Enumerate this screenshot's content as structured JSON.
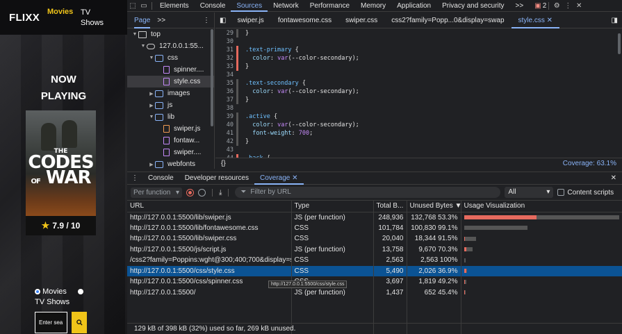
{
  "app": {
    "logo": "FLIXX",
    "nav_movies": "Movies",
    "nav_tv": "TV Shows",
    "now_playing": "NOW PLAYING",
    "poster_the": "THE",
    "poster_title_1": "CODES",
    "poster_of": "OF",
    "poster_title_2": "WAR",
    "rating": "7.9 / 10",
    "radio_movies": "Movies",
    "radio_tv": "TV Shows",
    "search_placeholder": "Enter sea",
    "search_icon": "search-icon"
  },
  "devtools": {
    "top_tabs": [
      "Elements",
      "Console",
      "Sources",
      "Network",
      "Performance",
      "Memory",
      "Application",
      "Privacy and security"
    ],
    "active_top_tab": "Sources",
    "more": ">>",
    "issues_count": "2",
    "navigator": {
      "tab": "Page",
      "more": ">>",
      "items": [
        {
          "label": "top",
          "depth": 0,
          "caret": "▼",
          "icon": "frame"
        },
        {
          "label": "127.0.0.1:55...",
          "depth": 1,
          "caret": "▼",
          "icon": "cloud"
        },
        {
          "label": "css",
          "depth": 2,
          "caret": "▼",
          "icon": "folder"
        },
        {
          "label": "spinner....",
          "depth": 3,
          "caret": "",
          "icon": "file-p"
        },
        {
          "label": "style.css",
          "depth": 3,
          "caret": "",
          "icon": "file-p",
          "selected": true
        },
        {
          "label": "images",
          "depth": 2,
          "caret": "▶",
          "icon": "folder"
        },
        {
          "label": "js",
          "depth": 2,
          "caret": "▶",
          "icon": "folder"
        },
        {
          "label": "lib",
          "depth": 2,
          "caret": "▼",
          "icon": "folder"
        },
        {
          "label": "swiper.js",
          "depth": 3,
          "caret": "",
          "icon": "file-o"
        },
        {
          "label": "fontaw...",
          "depth": 3,
          "caret": "",
          "icon": "file-p"
        },
        {
          "label": "swiper....",
          "depth": 3,
          "caret": "",
          "icon": "file-p"
        },
        {
          "label": "webfonts",
          "depth": 2,
          "caret": "▶",
          "icon": "folder"
        }
      ]
    },
    "editor": {
      "tabs": [
        "swiper.js",
        "fontawesome.css",
        "swiper.css",
        "css2?family=Popp...0&display=swap",
        "style.css"
      ],
      "active_tab": "style.css",
      "coverage": "Coverage: 63.1%",
      "format_icon": "{}",
      "lines": [
        {
          "n": "29",
          "m": "gray",
          "t": "}"
        },
        {
          "n": "30",
          "m": "",
          "t": ""
        },
        {
          "n": "31",
          "m": "red",
          "t": ".text-primary {"
        },
        {
          "n": "32",
          "m": "red",
          "t": "  color: var(--color-secondary);"
        },
        {
          "n": "33",
          "m": "red",
          "t": "}"
        },
        {
          "n": "34",
          "m": "",
          "t": ""
        },
        {
          "n": "35",
          "m": "gray",
          "t": ".text-secondary {"
        },
        {
          "n": "36",
          "m": "gray",
          "t": "  color: var(--color-secondary);"
        },
        {
          "n": "37",
          "m": "gray",
          "t": "}"
        },
        {
          "n": "38",
          "m": "",
          "t": ""
        },
        {
          "n": "39",
          "m": "gray",
          "t": ".active {"
        },
        {
          "n": "40",
          "m": "gray",
          "t": "  color: var(--color-secondary);"
        },
        {
          "n": "41",
          "m": "gray",
          "t": "  font-weight: 700;"
        },
        {
          "n": "42",
          "m": "gray",
          "t": "}"
        },
        {
          "n": "43",
          "m": "",
          "t": ""
        },
        {
          "n": "44",
          "m": "red",
          "t": ".back {"
        }
      ]
    },
    "drawer": {
      "tabs": [
        "Console",
        "Developer resources",
        "Coverage"
      ],
      "active_tab": "Coverage",
      "per_function": "Per function",
      "filter_placeholder": "Filter by URL",
      "all": "All",
      "content_scripts": "Content scripts",
      "columns": [
        "URL",
        "Type",
        "Total B...",
        "Unused Bytes ▼",
        "Usage Visualization"
      ],
      "rows": [
        {
          "url": "http://127.0.0.1:5500/lib/swiper.js",
          "type": "JS (per function)",
          "total": "248,936",
          "unused": "132,768",
          "pct": "53.3%",
          "used_frac": 0.467,
          "scale": 1.0
        },
        {
          "url": "http://127.0.0.1:5500/lib/fontawesome.css",
          "type": "CSS",
          "total": "101,784",
          "unused": "100,830",
          "pct": "99.1%",
          "used_frac": 0.009,
          "scale": 0.409
        },
        {
          "url": "http://127.0.0.1:5500/lib/swiper.css",
          "type": "CSS",
          "total": "20,040",
          "unused": "18,344",
          "pct": "91.5%",
          "used_frac": 0.085,
          "scale": 0.08
        },
        {
          "url": "http://127.0.0.1:5500/js/script.js",
          "type": "JS (per function)",
          "total": "13,758",
          "unused": "9,670",
          "pct": "70.3%",
          "used_frac": 0.297,
          "scale": 0.055
        },
        {
          "url": "/css2?family=Poppins:wght@300;400;700&display=swap",
          "type": "CSS",
          "total": "2,563",
          "unused": "2,563",
          "pct": "100%",
          "used_frac": 0.0,
          "scale": 0.01
        },
        {
          "url": "http://127.0.0.1:5500/css/style.css",
          "type": "CSS",
          "total": "5,490",
          "unused": "2,026",
          "pct": "36.9%",
          "used_frac": 0.631,
          "scale": 0.022,
          "highlight": true
        },
        {
          "url": "http://127.0.0.1:5500/css/spinner.css",
          "type": "CSS",
          "total": "3,697",
          "unused": "1,819",
          "pct": "49.2%",
          "used_frac": 0.508,
          "scale": 0.015
        },
        {
          "url": "http://127.0.0.1:5500/",
          "type": "JS (per function)",
          "total": "1,437",
          "unused": "652",
          "pct": "45.4%",
          "used_frac": 0.546,
          "scale": 0.006
        }
      ],
      "tooltip": "http://127.0.0.1:5500/css/style.css",
      "footer": "129 kB of 398 kB (32%) used so far, 269 kB unused."
    }
  }
}
